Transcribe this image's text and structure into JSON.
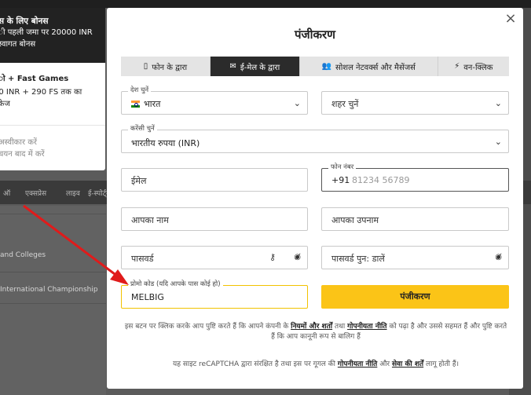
{
  "background": {
    "nav": [
      "ऑ",
      "एक्सप्रेस",
      "लाइव",
      "ई-स्पोर्ट्स"
    ],
    "rows": [
      "and Colleges",
      "International Championship"
    ]
  },
  "bonus_popup": {
    "title": "स के लिए बोनस",
    "line1": "ी पहली जमा पर 20000 INR",
    "line2": "स्वागत बोनस",
    "option_title": "ो + Fast Games",
    "option_line1": "00 INR + 290 FS तक का",
    "option_line2": "पैकेज",
    "reject_line1": "अस्वीकार करें",
    "reject_line2": "चयन बाद में करें"
  },
  "modal": {
    "close_label": "×",
    "title": "पंजीकरण",
    "tabs": [
      {
        "label": "फोन के द्वारा",
        "icon": "phone-icon",
        "active": false
      },
      {
        "label": "ई-मेल के द्वारा",
        "icon": "envelope-icon",
        "active": true
      },
      {
        "label": "सोशल नेटवर्क्स और मैसेंजर्स",
        "icon": "users-icon",
        "active": false
      },
      {
        "label": "वन-क्लिक",
        "icon": "bolt-icon",
        "active": false
      }
    ],
    "country": {
      "label": "देश चुनें",
      "value": "भारत"
    },
    "city": {
      "placeholder": "शहर चुनें"
    },
    "currency": {
      "label": "करेंसी चुनें",
      "value": "भारतीय रुपया (INR)"
    },
    "email": {
      "placeholder": "ईमेल"
    },
    "phone": {
      "label": "फोन नंबर",
      "code": "+91",
      "placeholder": "81234 56789"
    },
    "first_name": {
      "placeholder": "आपका नाम"
    },
    "last_name": {
      "placeholder": "आपका उपनाम"
    },
    "password": {
      "placeholder": "पासवर्ड"
    },
    "password_repeat": {
      "placeholder": "पासवर्ड पुन: डालें"
    },
    "promo": {
      "label": "प्रोमो कोड (यदि आपके पास कोई हो)",
      "value": "MELBIG"
    },
    "register_button": "पंजीकरण",
    "terms": {
      "part1": "इस बटन पर क्लिक करके आप पुष्टि करते हैं कि आपने कंपनी के",
      "link1": "नियमों और शर्तों",
      "part2": "तथा",
      "link2": "गोपनीयता नीति",
      "part3": "को पढ़ा है और उससे सहमत हैं और पुष्टि करते हैं कि आप कानूनी रूप से बालिग हैं"
    },
    "captcha": {
      "part1": "यह साइट reCAPTCHA द्वारा संरक्षित है तथा इस पर गूगल की",
      "link1": "गोपनीयता नीति",
      "part2": "और",
      "link2": "सेवा की शर्तें",
      "part3": "लागू होती हैं।"
    }
  },
  "colors": {
    "accent": "#fbc417",
    "active_tab": "#2b2b2b",
    "arrow": "#e01b1b"
  }
}
